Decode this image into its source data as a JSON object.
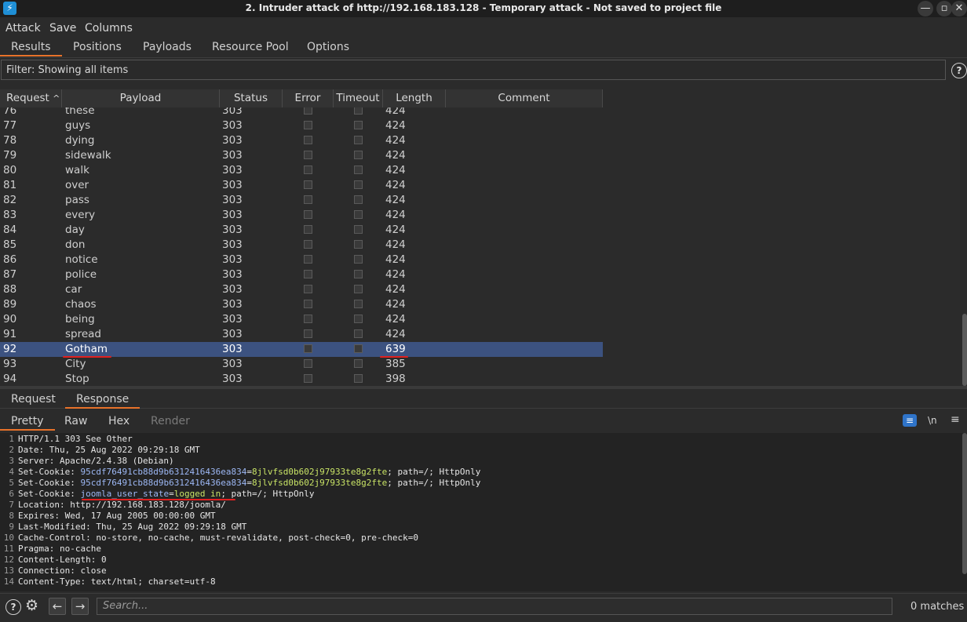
{
  "window": {
    "title": "2. Intruder attack of http://192.168.183.128 - Temporary attack - Not saved to project file",
    "app_icon": "⚡",
    "controls": [
      "—",
      "▫",
      "✕"
    ]
  },
  "menu": [
    "Attack",
    "Save",
    "Columns"
  ],
  "top_tabs": [
    "Results",
    "Positions",
    "Payloads",
    "Resource Pool",
    "Options"
  ],
  "active_top_tab": "Results",
  "filter": {
    "text": "Filter: Showing all items",
    "help": "?"
  },
  "table": {
    "columns": [
      "Request",
      "Payload",
      "Status",
      "Error",
      "Timeout",
      "Length",
      "Comment"
    ],
    "sort_indicator": "^",
    "rows": [
      [
        "76",
        "these",
        "303",
        "424"
      ],
      [
        "77",
        "guys",
        "303",
        "424"
      ],
      [
        "78",
        "dying",
        "303",
        "424"
      ],
      [
        "79",
        "sidewalk",
        "303",
        "424"
      ],
      [
        "80",
        "walk",
        "303",
        "424"
      ],
      [
        "81",
        "over",
        "303",
        "424"
      ],
      [
        "82",
        "pass",
        "303",
        "424"
      ],
      [
        "83",
        "every",
        "303",
        "424"
      ],
      [
        "84",
        "day",
        "303",
        "424"
      ],
      [
        "85",
        "don",
        "303",
        "424"
      ],
      [
        "86",
        "notice",
        "303",
        "424"
      ],
      [
        "87",
        "police",
        "303",
        "424"
      ],
      [
        "88",
        "car",
        "303",
        "424"
      ],
      [
        "89",
        "chaos",
        "303",
        "424"
      ],
      [
        "90",
        "being",
        "303",
        "424"
      ],
      [
        "91",
        "spread",
        "303",
        "424"
      ],
      [
        "92",
        "Gotham",
        "303",
        "639"
      ],
      [
        "93",
        "City",
        "303",
        "385"
      ],
      [
        "94",
        "Stop",
        "303",
        "398"
      ]
    ],
    "selected_request": "92"
  },
  "message_tabs": [
    "Request",
    "Response"
  ],
  "active_message_tab": "Response",
  "view_tabs": [
    "Pretty",
    "Raw",
    "Hex",
    "Render"
  ],
  "active_view_tab": "Pretty",
  "view_icons": {
    "wrap": "≡",
    "newline": "\\n",
    "menu": "≡"
  },
  "response_lines": [
    {
      "n": "1",
      "key": "HTTP/1.1 303 See Other",
      "rest": ""
    },
    {
      "n": "2",
      "key": "Date:",
      "rest": " Thu, 25 Aug 2022 09:29:18 GMT"
    },
    {
      "n": "3",
      "key": "Server:",
      "rest": " Apache/2.4.38 (Debian)"
    },
    {
      "n": "4",
      "key": "Set-Cookie:",
      "cname": "95cdf76491cb88d9b6312416436ea834",
      "cval": "8jlvfsd0b602j97933te8g2fte",
      "tail": "; path=/; HttpOnly"
    },
    {
      "n": "5",
      "key": "Set-Cookie:",
      "cname": "95cdf76491cb88d9b6312416436ea834",
      "cval": "8jlvfsd0b602j97933te8g2fte",
      "tail": "; path=/; HttpOnly"
    },
    {
      "n": "6",
      "key": "Set-Cookie:",
      "cname": "joomla_user_state",
      "cval": "logged in",
      "tail": "; path=/; HttpOnly"
    },
    {
      "n": "7",
      "key": "Location:",
      "rest": " http://192.168.183.128/joomla/"
    },
    {
      "n": "8",
      "key": "Expires:",
      "rest": " Wed, 17 Aug 2005 00:00:00 GMT"
    },
    {
      "n": "9",
      "key": "Last-Modified:",
      "rest": " Thu, 25 Aug 2022 09:29:18 GMT"
    },
    {
      "n": "10",
      "key": "Cache-Control:",
      "rest": " no-store, no-cache, must-revalidate, post-check=0, pre-check=0"
    },
    {
      "n": "11",
      "key": "Pragma:",
      "rest": " no-cache"
    },
    {
      "n": "12",
      "key": "Content-Length:",
      "rest": " 0"
    },
    {
      "n": "13",
      "key": "Connection:",
      "rest": " close"
    },
    {
      "n": "14",
      "key": "Content-Type:",
      "rest": " text/html; charset=utf-8"
    }
  ],
  "bottom": {
    "help": "?",
    "settings": "⚙",
    "back": "←",
    "forward": "→",
    "search_placeholder": "Search...",
    "matches": "0 matches"
  },
  "colors": {
    "accent": "#e8722a",
    "selected_row": "#3c5280",
    "annotation": "#e02020",
    "cookie_name": "#9db8f5",
    "cookie_value": "#c9e466"
  }
}
